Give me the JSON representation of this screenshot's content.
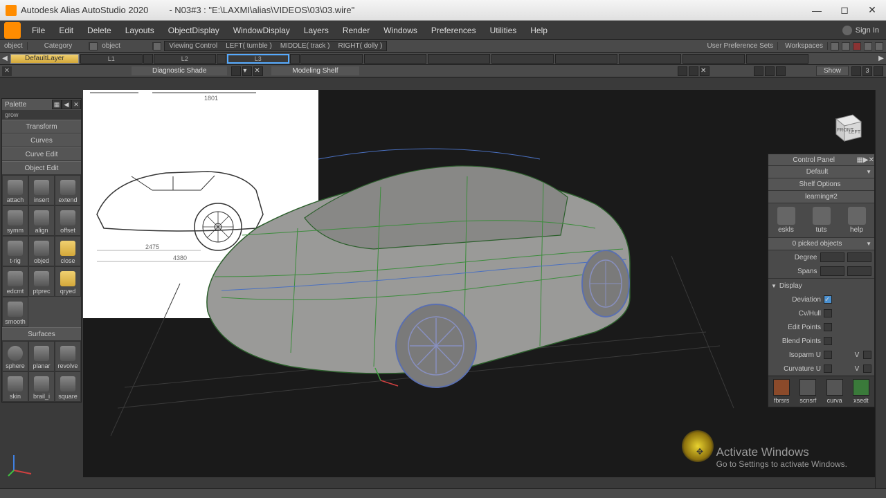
{
  "title": {
    "app": "Autodesk Alias AutoStudio 2020",
    "doc": "- N03#3 : \"E:\\LAXMI\\alias\\VIDEOS\\03\\03.wire\""
  },
  "menu": {
    "file": "File",
    "edit": "Edit",
    "delete": "Delete",
    "layouts": "Layouts",
    "object_display": "ObjectDisplay",
    "window_display": "WindowDisplay",
    "layers": "Layers",
    "render": "Render",
    "windows": "Windows",
    "preferences": "Preferences",
    "utilities": "Utilities",
    "help": "Help",
    "sign_in": "Sign In"
  },
  "secbar": {
    "object": "object",
    "category": "Category",
    "obj_field": "object",
    "viewing": "Viewing Control",
    "left": "LEFT( tumble )",
    "middle": "MIDDLE( track )",
    "right": "RIGHT( dolly )",
    "user_pref": "User Preference Sets",
    "workspaces": "Workspaces"
  },
  "layers": {
    "default": "DefaultLayer",
    "l1": "L1",
    "l2": "L2",
    "l3": "L3"
  },
  "shelf": {
    "diagnostic": "Diagnostic Shade",
    "modeling": "Modeling Shelf",
    "show": "Show",
    "three": "3"
  },
  "palette": {
    "title": "Palette",
    "grow": "grow",
    "transform": "Transform",
    "curves": "Curves",
    "curve_edit": "Curve Edit",
    "object_edit": "Object Edit",
    "surfaces": "Surfaces",
    "tools_oe": [
      "attach",
      "insert",
      "extend",
      "symm",
      "align",
      "offset",
      "t-rig",
      "objed",
      "close",
      "edcmt",
      "ptprec",
      "qryed",
      "smooth"
    ],
    "tools_surf": [
      "sphere",
      "planar",
      "revolve",
      "skin",
      "brail_i",
      "square"
    ]
  },
  "control": {
    "title": "Control Panel",
    "default": "Default",
    "shelf_opts": "Shelf Options",
    "learning": "learning#2",
    "tabs": [
      "eskls",
      "tuts",
      "help"
    ],
    "picked": "0 picked objects",
    "degree": "Degree",
    "spans": "Spans",
    "display": "Display",
    "deviation": "Deviation",
    "cvhull": "Cv/Hull",
    "edit_points": "Edit Points",
    "blend_points": "Blend Points",
    "isoparm_u": "Isoparm U",
    "curvature_u": "Curvature U",
    "v": "V",
    "bottom_tools": [
      "fbrsrs",
      "scnsrf",
      "curva",
      "xsedt"
    ]
  },
  "viewcube": {
    "front": "FRONT",
    "left": "LEFT"
  },
  "watermark": {
    "main": "Activate Windows",
    "sub": "Go to Settings to activate Windows."
  },
  "blueprint_dims": {
    "w": "1801",
    "l1": "2475",
    "l2": "4380"
  }
}
